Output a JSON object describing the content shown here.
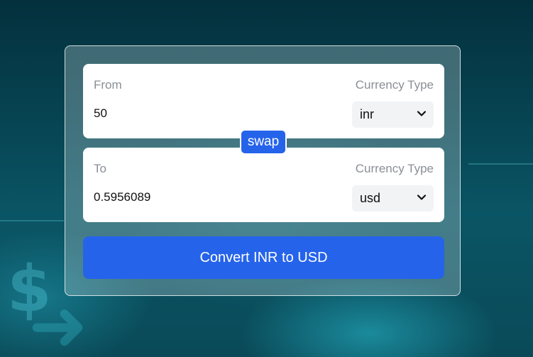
{
  "converter": {
    "from": {
      "label": "From",
      "currency_type_label": "Currency Type",
      "amount": "50",
      "currency": "inr"
    },
    "to": {
      "label": "To",
      "currency_type_label": "Currency Type",
      "amount": "0.5956089",
      "currency": "usd"
    },
    "swap_label": "swap",
    "convert_label": "Convert INR to USD"
  },
  "icons": {
    "select_chevron": "chevron-down-icon"
  },
  "colors": {
    "primary": "#2563eb",
    "label_gray": "#8a8f96",
    "select_bg": "#f1f3f5"
  }
}
